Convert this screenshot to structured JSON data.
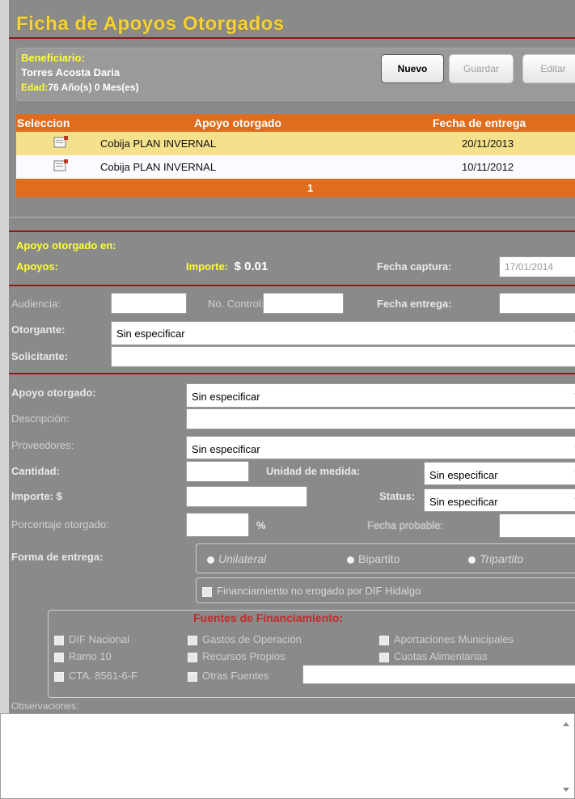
{
  "title": "Ficha de Apoyos Otorgados",
  "beneficiary": {
    "label": "Beneficiario:",
    "name": "Torres Acosta Daria",
    "age_label": "Edad:",
    "age_value": "76 Año(s) 0 Mes(es)"
  },
  "buttons": {
    "new": "Nuevo",
    "save": "Guardar",
    "edit": "Editar"
  },
  "grid": {
    "headers": [
      "Seleccion",
      "Apoyo otorgado",
      "Fecha de entrega"
    ],
    "rows": [
      {
        "apoyo": "Cobija PLAN INVERNAL",
        "fecha": "20/11/2013",
        "icon": "document-edit-icon"
      },
      {
        "apoyo": "Cobija PLAN INVERNAL",
        "fecha": "10/11/2012",
        "icon": "document-edit-icon"
      }
    ],
    "page": "1"
  },
  "section1": {
    "heading": "Apoyo otorgado en:",
    "apoyos_label": "Apoyos:",
    "importe_label": "Importe:",
    "importe_value": "$ 0.01",
    "fecha_captura_label": "Fecha captura:",
    "fecha_captura_value": "17/01/2014"
  },
  "form": {
    "audiencia_label": "Audiencia:",
    "no_control_label": "No. Control:",
    "fecha_entrega_label": "Fecha entrega:",
    "otorgante_label": "Otorgante:",
    "otorgante_value": "Sin especificar",
    "solicitante_label": "Solicitante:",
    "apoyo_otorgado_label": "Apoyo otorgado:",
    "apoyo_otorgado_value": "Sin especificar",
    "descripcion_label": "Descripción:",
    "proveedores_label": "Proveedores:",
    "proveedores_value": "Sin especificar",
    "cantidad_label": "Cantidad:",
    "unidad_label": "Unidad de medida:",
    "unidad_value": "Sin especificar",
    "importe_label": "Importe: $",
    "status_label": "Status:",
    "status_value": "Sin especificar",
    "porcentaje_label": "Porcentaje otorgado:",
    "percent_sign": "%",
    "fecha_probable_label": "Fecha probable:",
    "forma_entrega_label": "Forma de entrega:",
    "radio_options": [
      "Unilateral",
      "Bipartito",
      "Tripartito"
    ],
    "financiamiento_label": "Financiamiento no erogado por DIF Hidalgo"
  },
  "fuentes": {
    "title": "Fuentes de Financiamiento:",
    "col1": [
      "DIF Nacional",
      "Ramo 10",
      "CTA. 8561-6-F"
    ],
    "col2": [
      "Gastos de Operación",
      "Recursos Propios",
      "Otras Fuentes"
    ],
    "col3": [
      "Aportaciones Municipales",
      "Cuotas Alimentarias"
    ]
  },
  "observaciones_label": "Observaciones:",
  "colors": {
    "title_yellow": "#f5d23a",
    "grid_orange": "#e06c1d",
    "row_highlight": "#f5e08c",
    "divider_red": "#8b1a1a"
  }
}
